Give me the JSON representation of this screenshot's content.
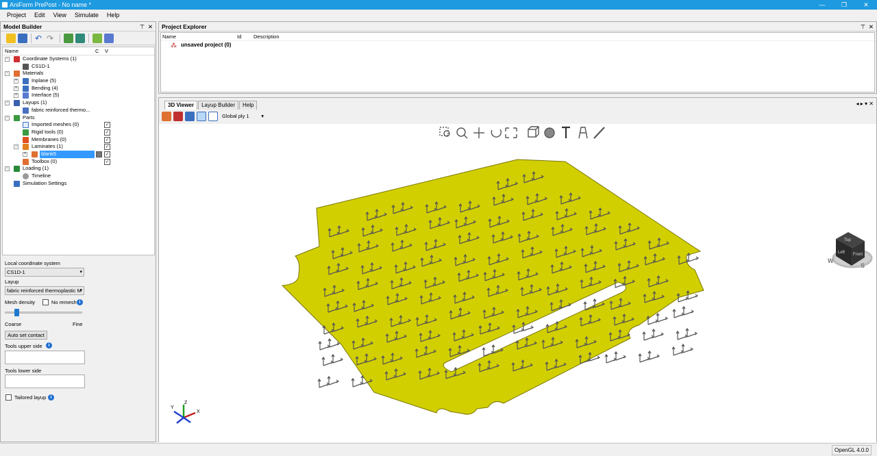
{
  "window": {
    "title": "AniForm PrePost - No name *"
  },
  "menu": [
    "Project",
    "Edit",
    "View",
    "Simulate",
    "Help"
  ],
  "model_builder": {
    "title": "Model Builder",
    "columns": {
      "name": "Name",
      "c": "C",
      "v": "V"
    },
    "tree": {
      "coord": "Coordinate Systems (1)",
      "cs1d": "CS1D-1",
      "materials": "Materials",
      "inplane": "Inplane (5)",
      "bending": "Bending (4)",
      "interface": "Interface (5)",
      "layups": "Layups (1)",
      "layup1": "fabric reinforced thermo...",
      "parts": "Parts",
      "imported": "Imported meshes (0)",
      "rigid": "Rigid tools (0)",
      "membranes": "Membranes (0)",
      "laminates": "Laminates (1)",
      "blank": "blank5",
      "toolbox": "Toolbox (0)",
      "loading": "Loading (1)",
      "timeline": "Timeline",
      "simsettings": "Simulation Settings"
    }
  },
  "properties": {
    "lcs_label": "Local coordinate system",
    "lcs_value": "CS1D-1",
    "layup_label": "Layup",
    "layup_value": "fabric reinforced thermoplastic M",
    "mesh_density_label": "Mesh density",
    "no_remesh_label": "No remesh",
    "mesh_density_level": 0.12,
    "coarse_label": "Coarse",
    "fine_label": "Fine",
    "auto_contact_label": "Auto set contact",
    "tools_upper_label": "Tools upper side",
    "tools_lower_label": "Tools lower side",
    "tailored_label": "Tailored layup"
  },
  "project_explorer": {
    "title": "Project Explorer",
    "col_name": "Name",
    "col_id": "Id",
    "col_desc": "Description",
    "project": "unsaved project (0)"
  },
  "viewer": {
    "tabs": [
      "3D Viewer",
      "Layup Builder",
      "Help"
    ],
    "ply_select": "Global ply 1",
    "cube": {
      "top": "Top",
      "left": "Left",
      "front": "Front"
    },
    "compass": {
      "w": "W",
      "s": "S"
    },
    "triad": {
      "x": "X",
      "y": "Y",
      "z": "Z"
    }
  },
  "status": {
    "opengl": "OpenGL 4.0.0"
  },
  "colors": {
    "titlebar": "#1e9ae0",
    "blank_fill": "#d4cf00",
    "selection": "#3399ff"
  }
}
